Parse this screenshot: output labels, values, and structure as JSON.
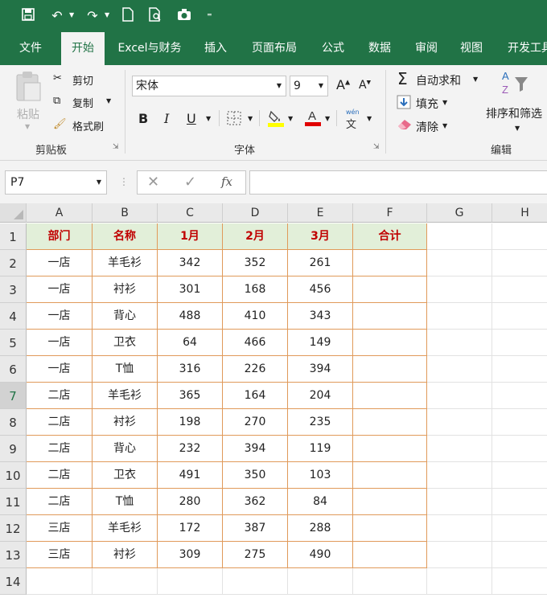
{
  "tabs": [
    "文件",
    "开始",
    "Excel与财务",
    "插入",
    "页面布局",
    "公式",
    "数据",
    "审阅",
    "视图",
    "开发工具"
  ],
  "active_tab": "开始",
  "ribbon": {
    "clipboard": {
      "paste": "粘贴",
      "cut": "剪切",
      "copy": "复制",
      "format_painter": "格式刷",
      "label": "剪贴板"
    },
    "font": {
      "name": "宋体",
      "size": "9",
      "bold": "B",
      "italic": "I",
      "underline": "U",
      "label": "字体",
      "phonetic": "wén"
    },
    "editing": {
      "autosum": "自动求和",
      "fill": "填充",
      "clear": "清除",
      "sort_filter": "排序和筛选",
      "label": "编辑"
    }
  },
  "formula_bar": {
    "name_box": "P7",
    "fx": "fx",
    "content": ""
  },
  "columns": [
    "A",
    "B",
    "C",
    "D",
    "E",
    "F",
    "G",
    "H"
  ],
  "rows": [
    "1",
    "2",
    "3",
    "4",
    "5",
    "6",
    "7",
    "8",
    "9",
    "10",
    "11",
    "12",
    "13",
    "14"
  ],
  "selected_row": "7",
  "table": {
    "headers": [
      "部门",
      "名称",
      "1月",
      "2月",
      "3月",
      "合计"
    ],
    "rows": [
      [
        "一店",
        "羊毛衫",
        "342",
        "352",
        "261",
        ""
      ],
      [
        "一店",
        "衬衫",
        "301",
        "168",
        "456",
        ""
      ],
      [
        "一店",
        "背心",
        "488",
        "410",
        "343",
        ""
      ],
      [
        "一店",
        "卫衣",
        "64",
        "466",
        "149",
        ""
      ],
      [
        "一店",
        "T恤",
        "316",
        "226",
        "394",
        ""
      ],
      [
        "二店",
        "羊毛衫",
        "365",
        "164",
        "204",
        ""
      ],
      [
        "二店",
        "衬衫",
        "198",
        "270",
        "235",
        ""
      ],
      [
        "二店",
        "背心",
        "232",
        "394",
        "119",
        ""
      ],
      [
        "二店",
        "卫衣",
        "491",
        "350",
        "103",
        ""
      ],
      [
        "二店",
        "T恤",
        "280",
        "362",
        "84",
        ""
      ],
      [
        "三店",
        "羊毛衫",
        "172",
        "387",
        "288",
        ""
      ],
      [
        "三店",
        "衬衫",
        "309",
        "275",
        "490",
        ""
      ]
    ]
  },
  "colors": {
    "accent": "#217346",
    "header_fill": "#e2efd9",
    "header_text": "#c00000",
    "table_border": "#e09a5a"
  }
}
